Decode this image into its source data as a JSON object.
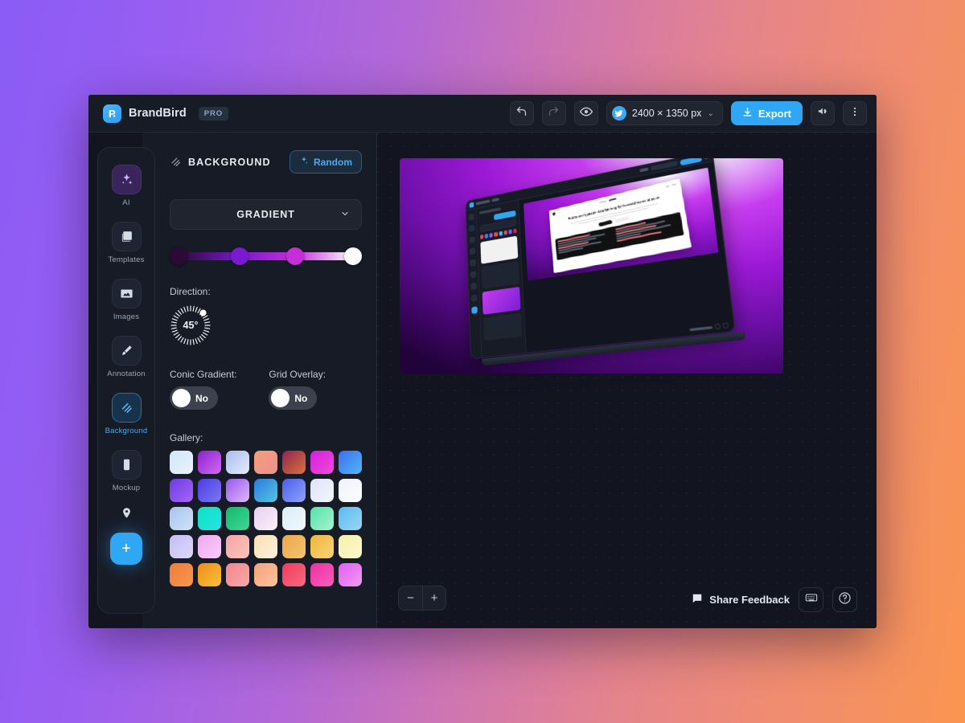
{
  "page": {
    "background_gradient": [
      "#8b5cf6",
      "#fa9550"
    ]
  },
  "topbar": {
    "brand_name": "BrandBird",
    "pro_badge": "PRO",
    "undo_icon": "undo-icon",
    "redo_icon": "redo-icon",
    "preview_icon": "eye-icon",
    "platform_icon": "twitter-icon",
    "canvas_size": "2400 × 1350 px",
    "size_chevron": "⌄",
    "export_label": "Export",
    "export_icon": "download-icon",
    "announce_icon": "megaphone-icon",
    "more_icon": "kebab-menu-icon",
    "accent_color": "#30a7f5"
  },
  "sidebar": {
    "items": [
      {
        "label": "AI",
        "icon": "sparkles-icon",
        "state": "ai"
      },
      {
        "label": "Templates",
        "icon": "templates-icon",
        "state": "normal"
      },
      {
        "label": "Images",
        "icon": "image-icon",
        "state": "normal"
      },
      {
        "label": "Annotation",
        "icon": "marker-icon",
        "state": "normal"
      },
      {
        "label": "Background",
        "icon": "stripes-icon",
        "state": "active"
      },
      {
        "label": "Mockup",
        "icon": "phone-icon",
        "state": "normal"
      },
      {
        "label": "",
        "icon": "location-pin-icon",
        "state": "plain"
      }
    ],
    "add_button": "+",
    "active_color": "#4fa9ea"
  },
  "panel": {
    "title": "BACKGROUND",
    "title_icon": "stripes-icon",
    "random_label": "Random",
    "random_icon": "sparkle-icon",
    "type_value": "GRADIENT",
    "type_chevron": "⌄",
    "gradient_stops": [
      {
        "color": "#2b0b33",
        "position": 0
      },
      {
        "color": "#7a19cf",
        "position": 35
      },
      {
        "color": "#c62ed9",
        "position": 67
      },
      {
        "color": "#ffffff",
        "position": 100
      }
    ],
    "direction_label": "Direction:",
    "direction_value": "45°",
    "conic_label": "Conic Gradient:",
    "conic_value": "No",
    "grid_label": "Grid Overlay:",
    "grid_value": "No",
    "gallery_label": "Gallery:",
    "gallery": [
      [
        "#cfe6f7,#eaf4fc",
        "#8e1fcf,#d06bf2",
        "#a8bdf0,#e3ecfb",
        "#f2a07b,#ee8f8f",
        "#8b2550,#e0703c",
        "#d41ee0,#f14bd6",
        "#3f6df0,#4fb8f2"
      ],
      [
        "#6b3ae8,#a866f2",
        "#4b3ae8,#7d7af0",
        "#9b55f0,#e0b9f7",
        "#2a7ae0,#57c6df",
        "#4a5ef0,#8fa3f5",
        "#dde4fb,#f3f6fd",
        "#eef3fb,#fdfdfd"
      ],
      [
        "#a8c4ef,#cfe3f7",
        "#0fe0c8,#25e4e0",
        "#12b96a,#3fd79a",
        "#e8d0f2,#fbf0f7",
        "#dcecf7,#f0f8fd",
        "#52e3a8,#a9f2cf",
        "#5bb9ef,#9bd6f7"
      ],
      [
        "#c3bcf5,#ddd8fa",
        "#efa8f2,#f8cdf8",
        "#f6a3a3,#fac6bc",
        "#f8dfb5,#fdf2dc",
        "#eba748,#f4c473",
        "#f0b53a,#f8d57a",
        "#f7f0a8,#fcf8d0"
      ],
      [
        "#f07a3a,#f6994f",
        "#f08a1a,#f6c23a",
        "#f3868f,#f7a8a8",
        "#f5a07a,#f9c49c",
        "#f23a5e,#f76a80",
        "#ef2fa0,#f75fc0",
        "#e55ef0,#f09af5"
      ]
    ]
  },
  "canvas": {
    "artwork_headline": "End-to-end typesafe data fetching for frontend teams at scale",
    "zoom_out": "−",
    "zoom_in": "+",
    "feedback_label": "Share Feedback",
    "feedback_icon": "chat-icon",
    "keyboard_icon": "keyboard-icon",
    "help_icon": "help-circle-icon"
  }
}
